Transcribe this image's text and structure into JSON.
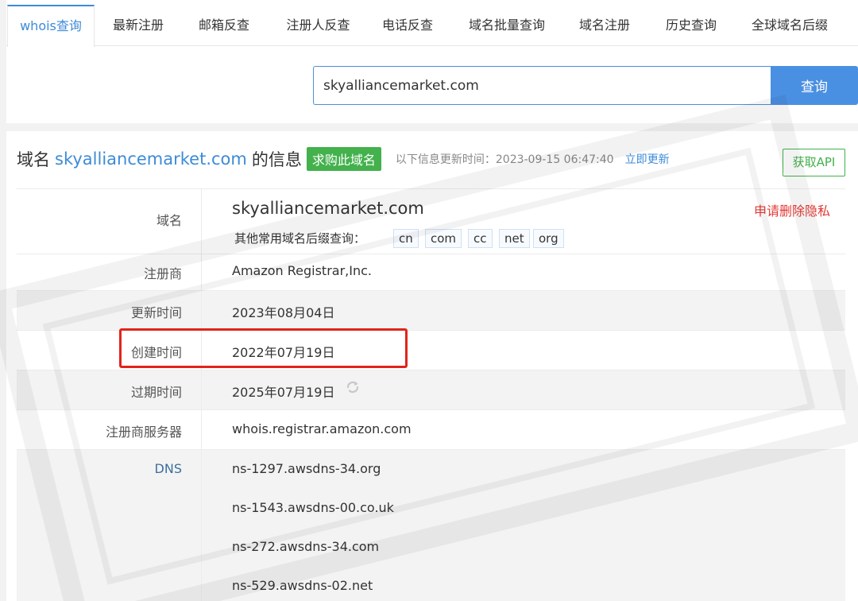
{
  "tabs": [
    "whois查询",
    "最新注册",
    "邮箱反查",
    "注册人反查",
    "电话反查",
    "域名批量查询",
    "域名注册",
    "历史查询",
    "全球域名后缀"
  ],
  "search": {
    "value": "skyalliancemarket.com",
    "button": "查询"
  },
  "header": {
    "prefix": "域名",
    "domain": "skyalliancemarket.com",
    "suffix": "的信息",
    "buy_label": "求购此域名",
    "update_label": "以下信息更新时间：2023-09-15 06:47:40",
    "update_link": "立即更新",
    "api_button": "获取API"
  },
  "whois": {
    "domain_label": "域名",
    "domain_value": "skyalliancemarket.com",
    "privacy_link": "申请删除隐私",
    "suffix_query_label": "其他常用域名后缀查询：",
    "suffixes": [
      "cn",
      "com",
      "cc",
      "net",
      "org"
    ],
    "registrar_label": "注册商",
    "registrar_value": "Amazon Registrar,Inc.",
    "updated_label": "更新时间",
    "updated_value": "2023年08月04日",
    "created_label": "创建时间",
    "created_value": "2022年07月19日",
    "expires_label": "过期时间",
    "expires_value": "2025年07月19日",
    "whois_server_label": "注册商服务器",
    "whois_server_value": "whois.registrar.amazon.com",
    "dns_label": "DNS",
    "dns": [
      "ns-1297.awsdns-34.org",
      "ns-1543.awsdns-00.co.uk",
      "ns-272.awsdns-34.com",
      "ns-529.awsdns-02.net"
    ]
  },
  "colors": {
    "accent": "#3d8bd8",
    "search_button": "#4a90e2",
    "buy_badge": "#43b14c",
    "privacy_link": "#e53935",
    "highlight_border": "#e1251b"
  }
}
